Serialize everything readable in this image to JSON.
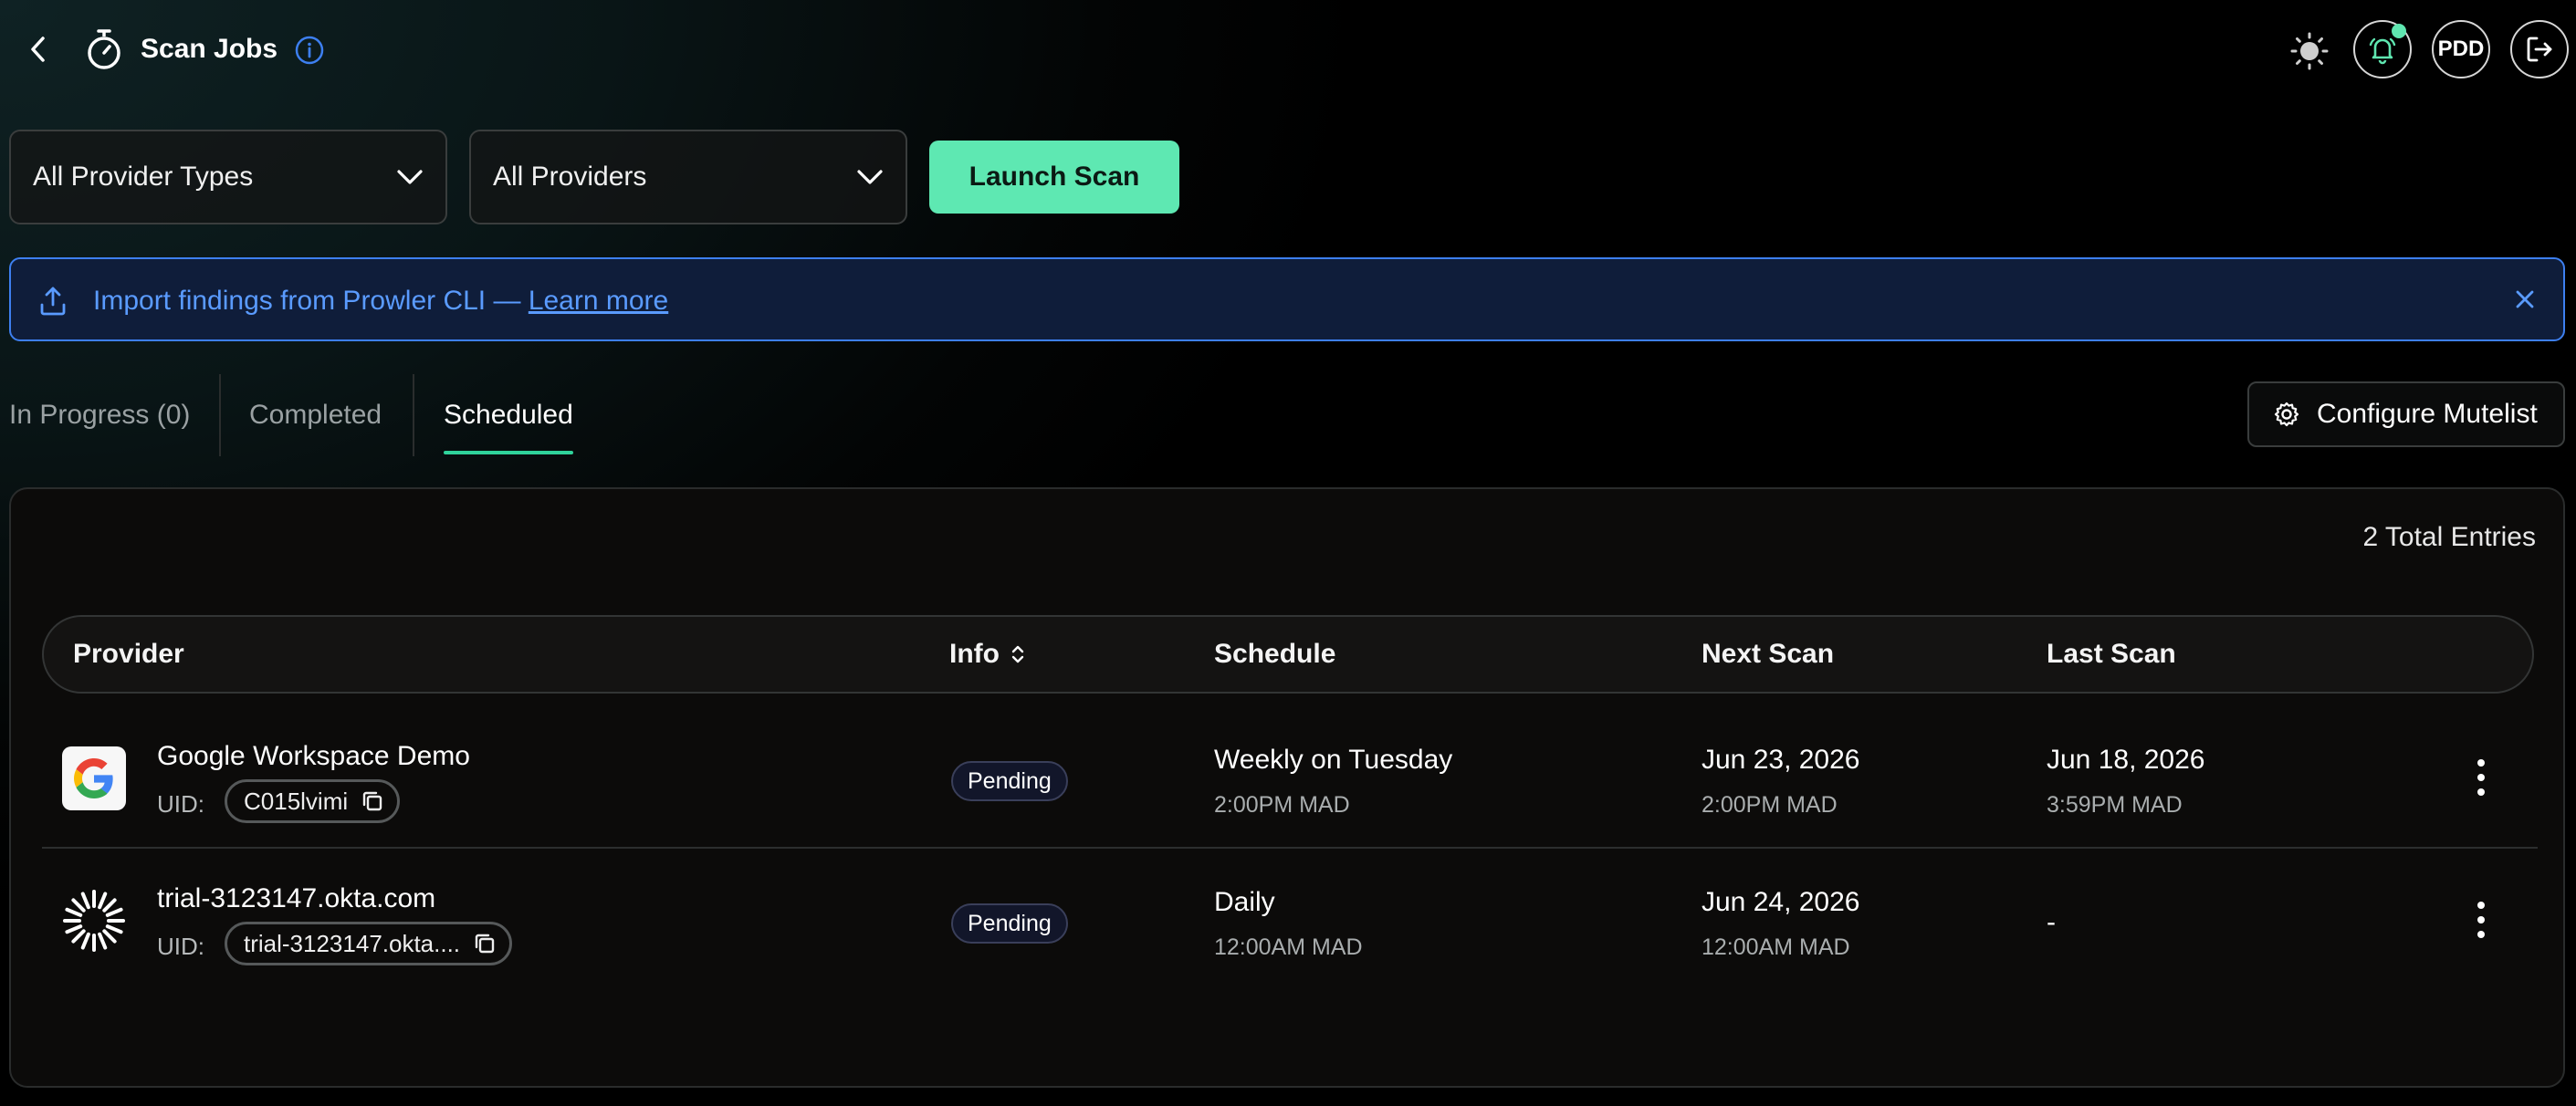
{
  "header": {
    "title": "Scan Jobs",
    "avatar_initials": "PDD",
    "icons": {
      "back": "chevron-left-icon",
      "timer": "stopwatch-icon",
      "info": "info-circle-icon",
      "theme": "sun-icon",
      "notifications": "bell-icon",
      "logout": "logout-icon"
    },
    "notification_dot_color": "#5fe6b0"
  },
  "filters": {
    "provider_type": {
      "value": "All Provider Types"
    },
    "provider": {
      "value": "All Providers"
    },
    "launch_label": "Launch Scan",
    "accent_color": "#5ee8b2"
  },
  "banner": {
    "text": "Import findings from Prowler CLI — ",
    "link": "Learn more",
    "color": "#5a9bff"
  },
  "tabs": [
    {
      "label": "In Progress (0)",
      "active": false
    },
    {
      "label": "Completed",
      "active": false
    },
    {
      "label": "Scheduled",
      "active": true
    }
  ],
  "mutelist_label": "Configure Mutelist",
  "table": {
    "total_entries": "2 Total Entries",
    "columns": [
      "Provider",
      "Info",
      "Schedule",
      "Next Scan",
      "Last Scan"
    ],
    "uid_label": "UID:",
    "rows": [
      {
        "provider_name": "Google Workspace Demo",
        "provider_icon": "google-logo-icon",
        "uid": "C015lvimi",
        "status": "Pending",
        "schedule": "Weekly on Tuesday",
        "schedule_time": "2:00PM MAD",
        "next_date": "Jun 23, 2026",
        "next_time": "2:00PM MAD",
        "last_date": "Jun 18, 2026",
        "last_time": "3:59PM MAD"
      },
      {
        "provider_name": "trial-3123147.okta.com",
        "provider_icon": "okta-logo-icon",
        "uid": "trial-3123147.okta....",
        "status": "Pending",
        "schedule": "Daily",
        "schedule_time": "12:00AM MAD",
        "next_date": "Jun 24, 2026",
        "next_time": "12:00AM MAD",
        "last_date": "-",
        "last_time": ""
      }
    ]
  }
}
